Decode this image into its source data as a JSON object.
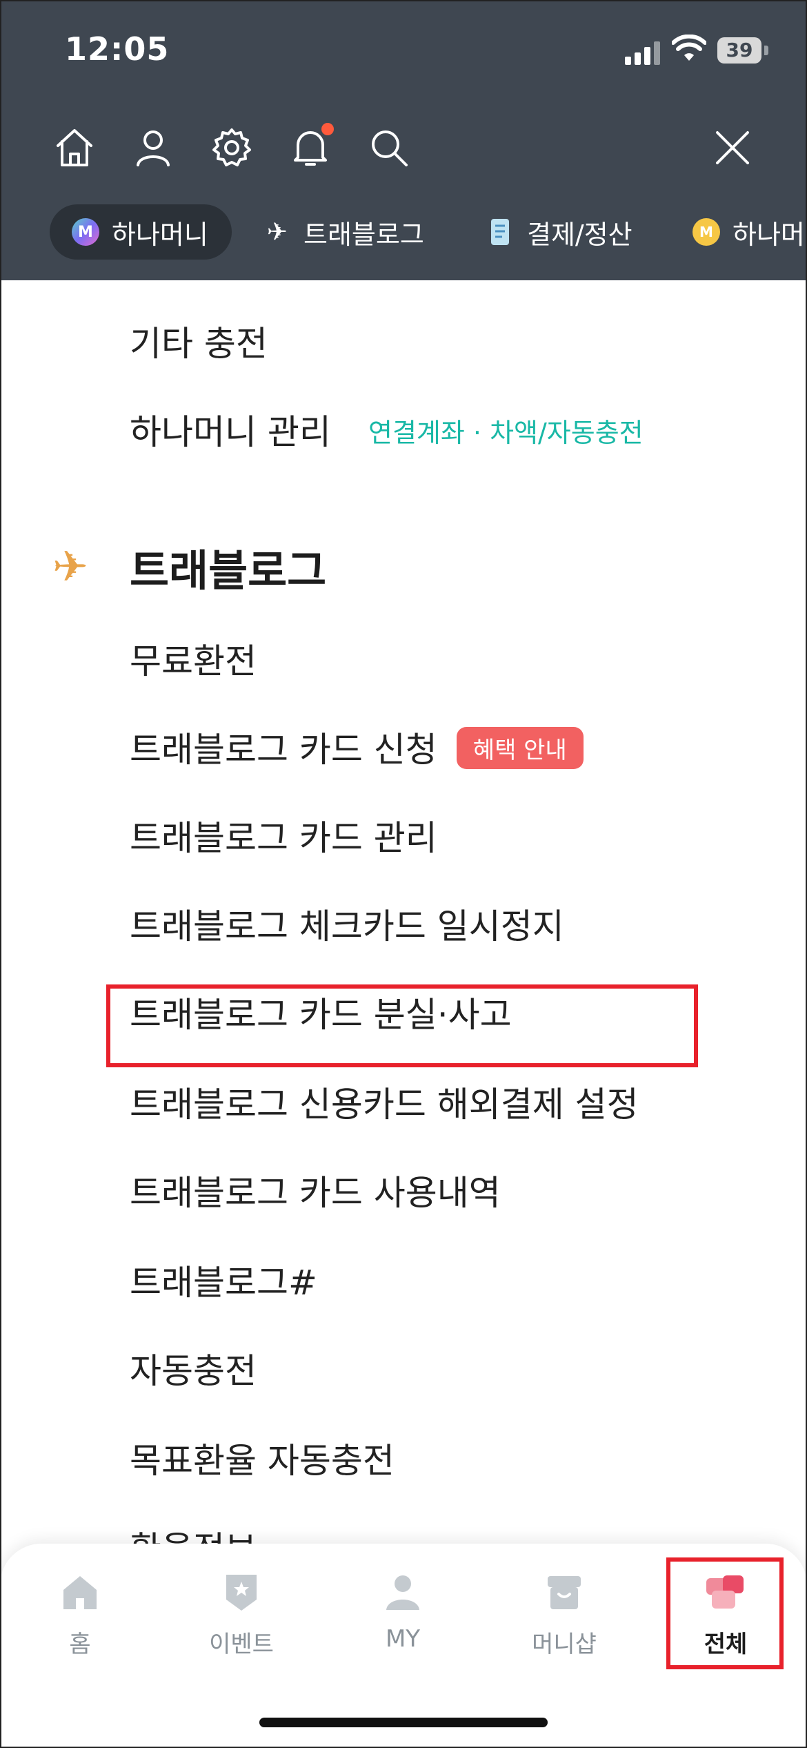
{
  "status": {
    "time": "12:05",
    "battery": "39"
  },
  "colors": {
    "header_bg": "#3f4751",
    "accent_teal": "#19b8a6",
    "badge_red": "#f26161",
    "highlight_red": "#e8212b"
  },
  "nav_icons": [
    "home-icon",
    "user-icon",
    "gear-icon",
    "bell-icon",
    "search-icon",
    "close-icon"
  ],
  "chips": [
    {
      "label": "하나머니",
      "icon": "hanamoney-icon",
      "active": true
    },
    {
      "label": "트래블로그",
      "icon": "airplane-icon"
    },
    {
      "label": "결제/정산",
      "icon": "receipt-icon"
    },
    {
      "label": "하나머",
      "icon": "coin-icon"
    }
  ],
  "menu": {
    "prev_items": {
      "etc_charge": "기타 충전",
      "hanamoney_manage": "하나머니 관리",
      "hanamoney_manage_sub": "연결계좌 · 차액/자동충전"
    },
    "section_title": "트래블로그",
    "items": [
      "무료환전",
      "트래블로그 카드 신청",
      "트래블로그 카드 관리",
      "트래블로그 체크카드 일시정지",
      "트래블로그 카드 분실·사고",
      "트래블로그 신용카드 해외결제 설정",
      "트래블로그 카드 사용내역",
      "트래블로그#",
      "자동충전",
      "목표환율 자동충전",
      "환율정보"
    ],
    "apply_badge": "혜택 안내"
  },
  "tabs": [
    {
      "label": "홈",
      "icon": "home-tab-icon"
    },
    {
      "label": "이벤트",
      "icon": "event-icon"
    },
    {
      "label": "MY",
      "icon": "my-icon"
    },
    {
      "label": "머니샵",
      "icon": "shop-icon"
    },
    {
      "label": "전체",
      "icon": "all-menu-icon",
      "active": true
    }
  ]
}
